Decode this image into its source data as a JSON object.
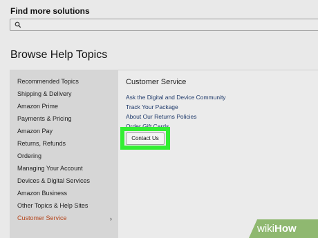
{
  "header": {
    "find_title": "Find more solutions",
    "search_placeholder": ""
  },
  "browse_title": "Browse Help Topics",
  "sidebar": {
    "items": [
      {
        "label": "Recommended Topics"
      },
      {
        "label": "Shipping & Delivery"
      },
      {
        "label": "Amazon Prime"
      },
      {
        "label": "Payments & Pricing"
      },
      {
        "label": "Amazon Pay"
      },
      {
        "label": "Returns, Refunds"
      },
      {
        "label": "Ordering"
      },
      {
        "label": "Managing Your Account"
      },
      {
        "label": "Devices & Digital Services"
      },
      {
        "label": "Amazon Business"
      },
      {
        "label": "Other Topics & Help Sites"
      },
      {
        "label": "Customer Service"
      }
    ],
    "active_chevron": "›",
    "active_color": "#b5451b"
  },
  "panel": {
    "title": "Customer Service",
    "links": [
      {
        "label": "Ask the Digital and Device Community"
      },
      {
        "label": "Track Your Package"
      },
      {
        "label": "About Our Returns Policies"
      },
      {
        "label": "Order Gift Cards"
      }
    ],
    "contact_button": "Contact Us",
    "highlight_color": "#33ee33"
  },
  "watermark": {
    "part1": "wiki",
    "part2": "How"
  },
  "icons": {
    "search": "search-icon",
    "chevron": "chevron-right-icon"
  }
}
